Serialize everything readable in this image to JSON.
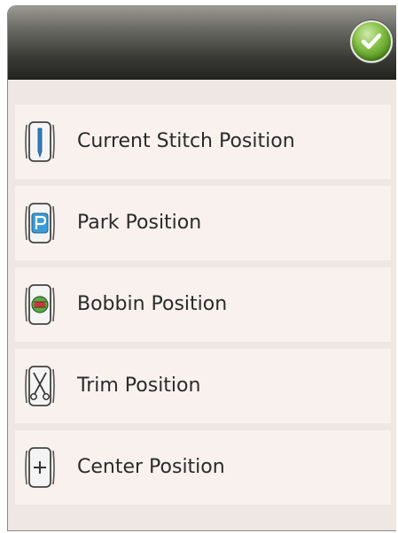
{
  "header": {
    "confirm_icon": "checkmark-icon",
    "confirm_color": "#6bab2f"
  },
  "items": [
    {
      "label": "Current Stitch Position",
      "icon": "needle-icon"
    },
    {
      "label": "Park Position",
      "icon": "park-icon"
    },
    {
      "label": "Bobbin Position",
      "icon": "bobbin-icon"
    },
    {
      "label": "Trim Position",
      "icon": "scissors-icon"
    },
    {
      "label": "Center Position",
      "icon": "center-plus-icon"
    }
  ]
}
